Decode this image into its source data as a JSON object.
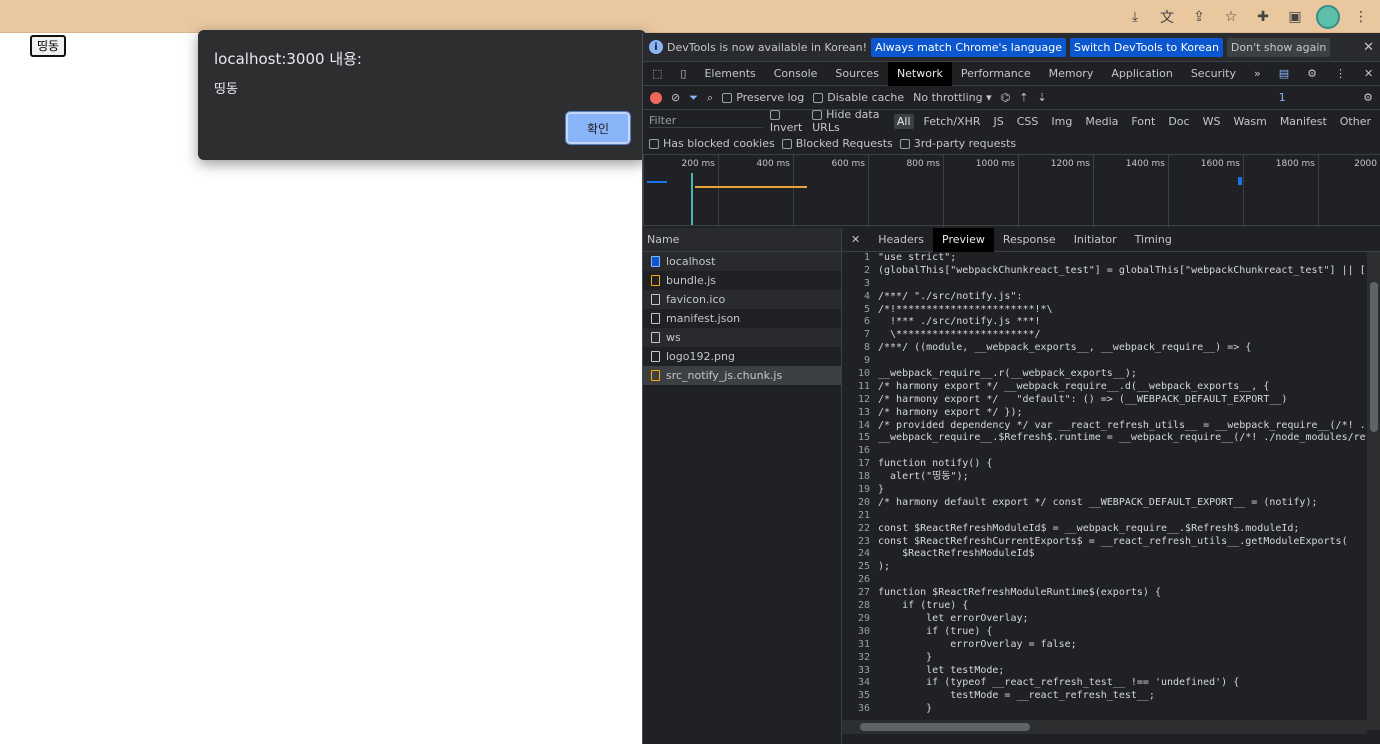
{
  "browser": {
    "toolbar_icons": [
      "download-icon",
      "translate-icon",
      "share-icon",
      "star-icon",
      "extensions-icon",
      "sidepanel-icon",
      "profile-avatar",
      "menu-icon"
    ]
  },
  "page": {
    "button_label": "띵동"
  },
  "alert": {
    "title": "localhost:3000 내용:",
    "message": "띵동",
    "ok_label": "확인"
  },
  "devtools": {
    "infobar": {
      "message": "DevTools is now available in Korean!",
      "btn_match": "Always match Chrome's language",
      "btn_switch": "Switch DevTools to Korean",
      "btn_dont": "Don't show again"
    },
    "tabs": [
      "Elements",
      "Console",
      "Sources",
      "Network",
      "Performance",
      "Memory",
      "Application",
      "Security"
    ],
    "issues_count": "1",
    "toolbar": {
      "preserve_log": "Preserve log",
      "disable_cache": "Disable cache",
      "throttling": "No throttling"
    },
    "filter": {
      "placeholder": "Filter",
      "invert": "Invert",
      "hide_data_urls": "Hide data URLs",
      "types": [
        "All",
        "Fetch/XHR",
        "JS",
        "CSS",
        "Img",
        "Media",
        "Font",
        "Doc",
        "WS",
        "Wasm",
        "Manifest",
        "Other"
      ],
      "blocked_cookies": "Has blocked cookies",
      "blocked_requests": "Blocked Requests",
      "third_party": "3rd-party requests"
    },
    "timeline_ticks": [
      "200 ms",
      "400 ms",
      "600 ms",
      "800 ms",
      "1000 ms",
      "1200 ms",
      "1400 ms",
      "1600 ms",
      "1800 ms",
      "2000"
    ],
    "name_header": "Name",
    "files": [
      "localhost",
      "bundle.js",
      "favicon.ico",
      "manifest.json",
      "ws",
      "logo192.png",
      "src_notify_js.chunk.js"
    ],
    "preview_tabs": [
      "Headers",
      "Preview",
      "Response",
      "Initiator",
      "Timing"
    ],
    "code_lines": [
      "\"use strict\";",
      "(globalThis[\"webpackChunkreact_test\"] = globalThis[\"webpackChunkreact_test\"] || [",
      "",
      "/***/ \"./src/notify.js\":",
      "/*!***********************!*\\",
      "  !*** ./src/notify.js ***!",
      "  \\***********************/",
      "/***/ ((module, __webpack_exports__, __webpack_require__) => {",
      "",
      "__webpack_require__.r(__webpack_exports__);",
      "/* harmony export */ __webpack_require__.d(__webpack_exports__, {",
      "/* harmony export */   \"default\": () => (__WEBPACK_DEFAULT_EXPORT__)",
      "/* harmony export */ });",
      "/* provided dependency */ var __react_refresh_utils__ = __webpack_require__(/*! .",
      "__webpack_require__.$Refresh$.runtime = __webpack_require__(/*! ./node_modules/re",
      "",
      "function notify() {",
      "  alert(\"띵동\");",
      "}",
      "/* harmony default export */ const __WEBPACK_DEFAULT_EXPORT__ = (notify);",
      "",
      "const $ReactRefreshModuleId$ = __webpack_require__.$Refresh$.moduleId;",
      "const $ReactRefreshCurrentExports$ = __react_refresh_utils__.getModuleExports(",
      "    $ReactRefreshModuleId$",
      ");",
      "",
      "function $ReactRefreshModuleRuntime$(exports) {",
      "    if (true) {",
      "        let errorOverlay;",
      "        if (true) {",
      "            errorOverlay = false;",
      "        }",
      "        let testMode;",
      "        if (typeof __react_refresh_test__ !== 'undefined') {",
      "            testMode = __react_refresh_test__;",
      "        }"
    ]
  }
}
